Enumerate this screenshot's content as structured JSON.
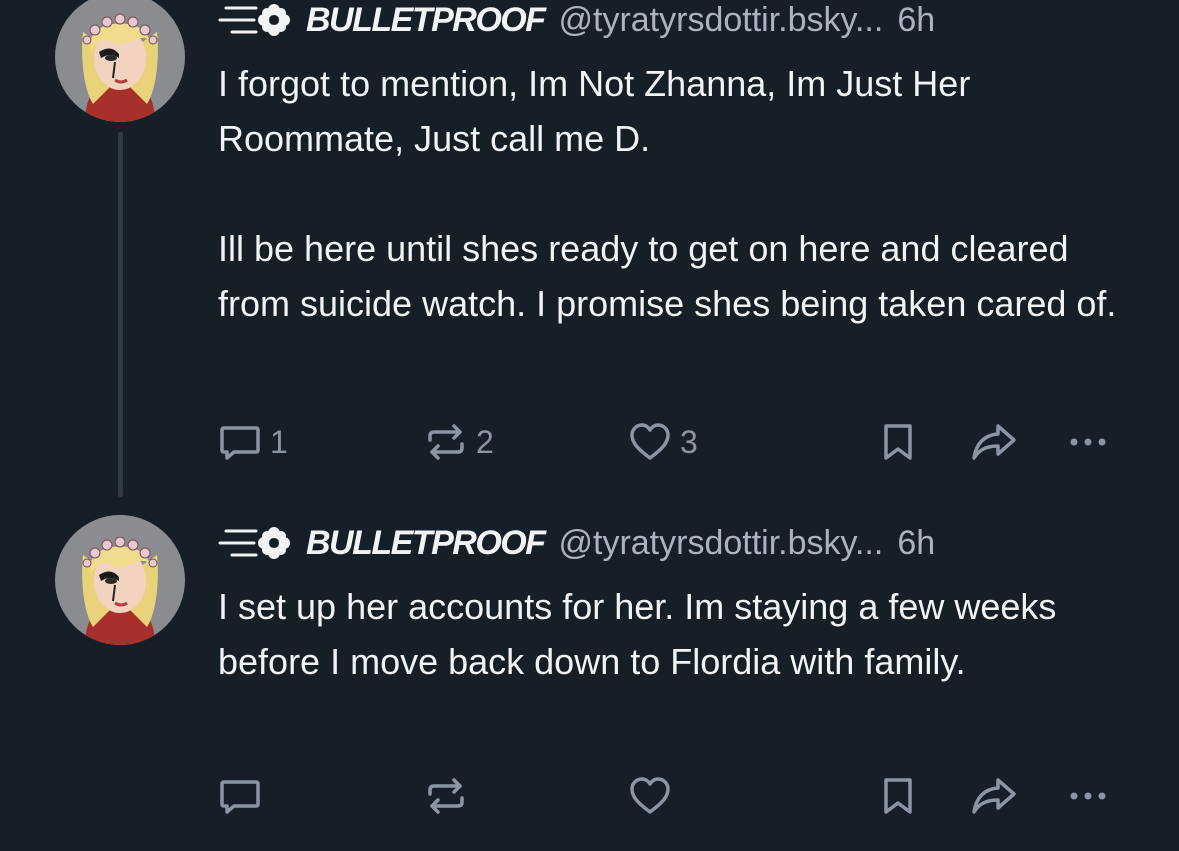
{
  "colors": {
    "background": "#161e27",
    "text_primary": "#f1f3f5",
    "text_secondary": "#aab4c0",
    "icon": "#8a96a4",
    "thread_line": "#2e3946"
  },
  "posts": [
    {
      "author": {
        "display_name": "BULLETPROOF",
        "handle": "@tyratyrsdottir.bsky...",
        "name_emoji": "speeding-flower-emoji",
        "avatar": "flower-crown-avatar"
      },
      "time": "6h",
      "paragraphs": [
        "I forgot to mention, Im Not Zhanna, Im Just Her Roommate, Just call me D.",
        "Ill be here until shes ready to get on here and cleared from suicide watch. I promise shes being taken cared of."
      ],
      "stats": {
        "replies": "1",
        "reposts": "2",
        "likes": "3"
      },
      "icons": [
        "reply-icon",
        "repost-icon",
        "like-icon",
        "bookmark-icon",
        "share-icon",
        "more-icon"
      ]
    },
    {
      "author": {
        "display_name": "BULLETPROOF",
        "handle": "@tyratyrsdottir.bsky...",
        "name_emoji": "speeding-flower-emoji",
        "avatar": "flower-crown-avatar"
      },
      "time": "6h",
      "paragraphs": [
        "I set up her accounts for her. Im staying a few weeks before I move back down to Flordia with family."
      ],
      "stats": {
        "replies": "",
        "reposts": "",
        "likes": ""
      },
      "icons": [
        "reply-icon",
        "repost-icon",
        "like-icon",
        "bookmark-icon",
        "share-icon",
        "more-icon"
      ]
    }
  ]
}
